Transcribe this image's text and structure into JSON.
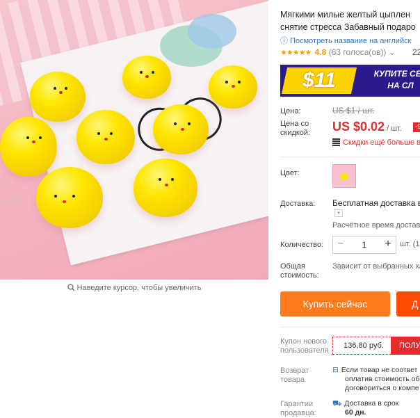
{
  "gallery": {
    "zoom_hint": "Наведите курсор, чтобы увеличить"
  },
  "product": {
    "title_line1": "Мягкими милые желтый цыплен",
    "title_line2": "снятие стресса Забавный подаро",
    "translate_link": "Посмотреть название на английск",
    "stars": "★★★★★",
    "rating": "4.8",
    "votes": "(63 голоса(ов))",
    "orders": "22"
  },
  "banner": {
    "amount": "$11",
    "text_line1": "КУПИТЕ СЕЙ",
    "text_line2": "НА СЛ"
  },
  "price": {
    "label": "Цена:",
    "old": "US $1 / шт.",
    "discount_label_1": "Цена со",
    "discount_label_2": "скидкой:",
    "new": "US $0.02",
    "unit": " / шт.",
    "discount_badge": "-9",
    "qr_text": "Скидки ещё больше в"
  },
  "options": {
    "color_label": "Цвет:"
  },
  "shipping": {
    "label": "Доставка:",
    "value": "Бесплатная доставка в",
    "estimate": "Расчётное время доставк"
  },
  "quantity": {
    "label": "Количество:",
    "minus": "−",
    "value": "1",
    "plus": "+",
    "unit": "шт. (1"
  },
  "total": {
    "label_1": "Общая",
    "label_2": "стоимость:",
    "value": "Зависит от выбранных ха"
  },
  "actions": {
    "buy_now": "Купить сейчас",
    "add_to_cart": "Д"
  },
  "coupon": {
    "label_1": "Купон нового",
    "label_2": "пользователя",
    "value": "136,80 руб.",
    "button": "ПОЛУ"
  },
  "returns": {
    "label_1": "Возврат",
    "label_2": "товара",
    "line1": "Если товар не соответ",
    "line2": "оплатив стоимость об",
    "line3": "договориться о компе"
  },
  "guarantee": {
    "label_1": "Гарантии",
    "label_2": "продавца:",
    "line1": "Доставка в срок",
    "line2": "60 дн."
  },
  "colors": {
    "accent_orange": "#ff7a1a",
    "cart_red": "#ff4800",
    "price_red": "#e02d2d",
    "link_blue": "#2f74c0",
    "banner_purple": "#2a1a8c",
    "banner_yellow": "#ffd400"
  }
}
